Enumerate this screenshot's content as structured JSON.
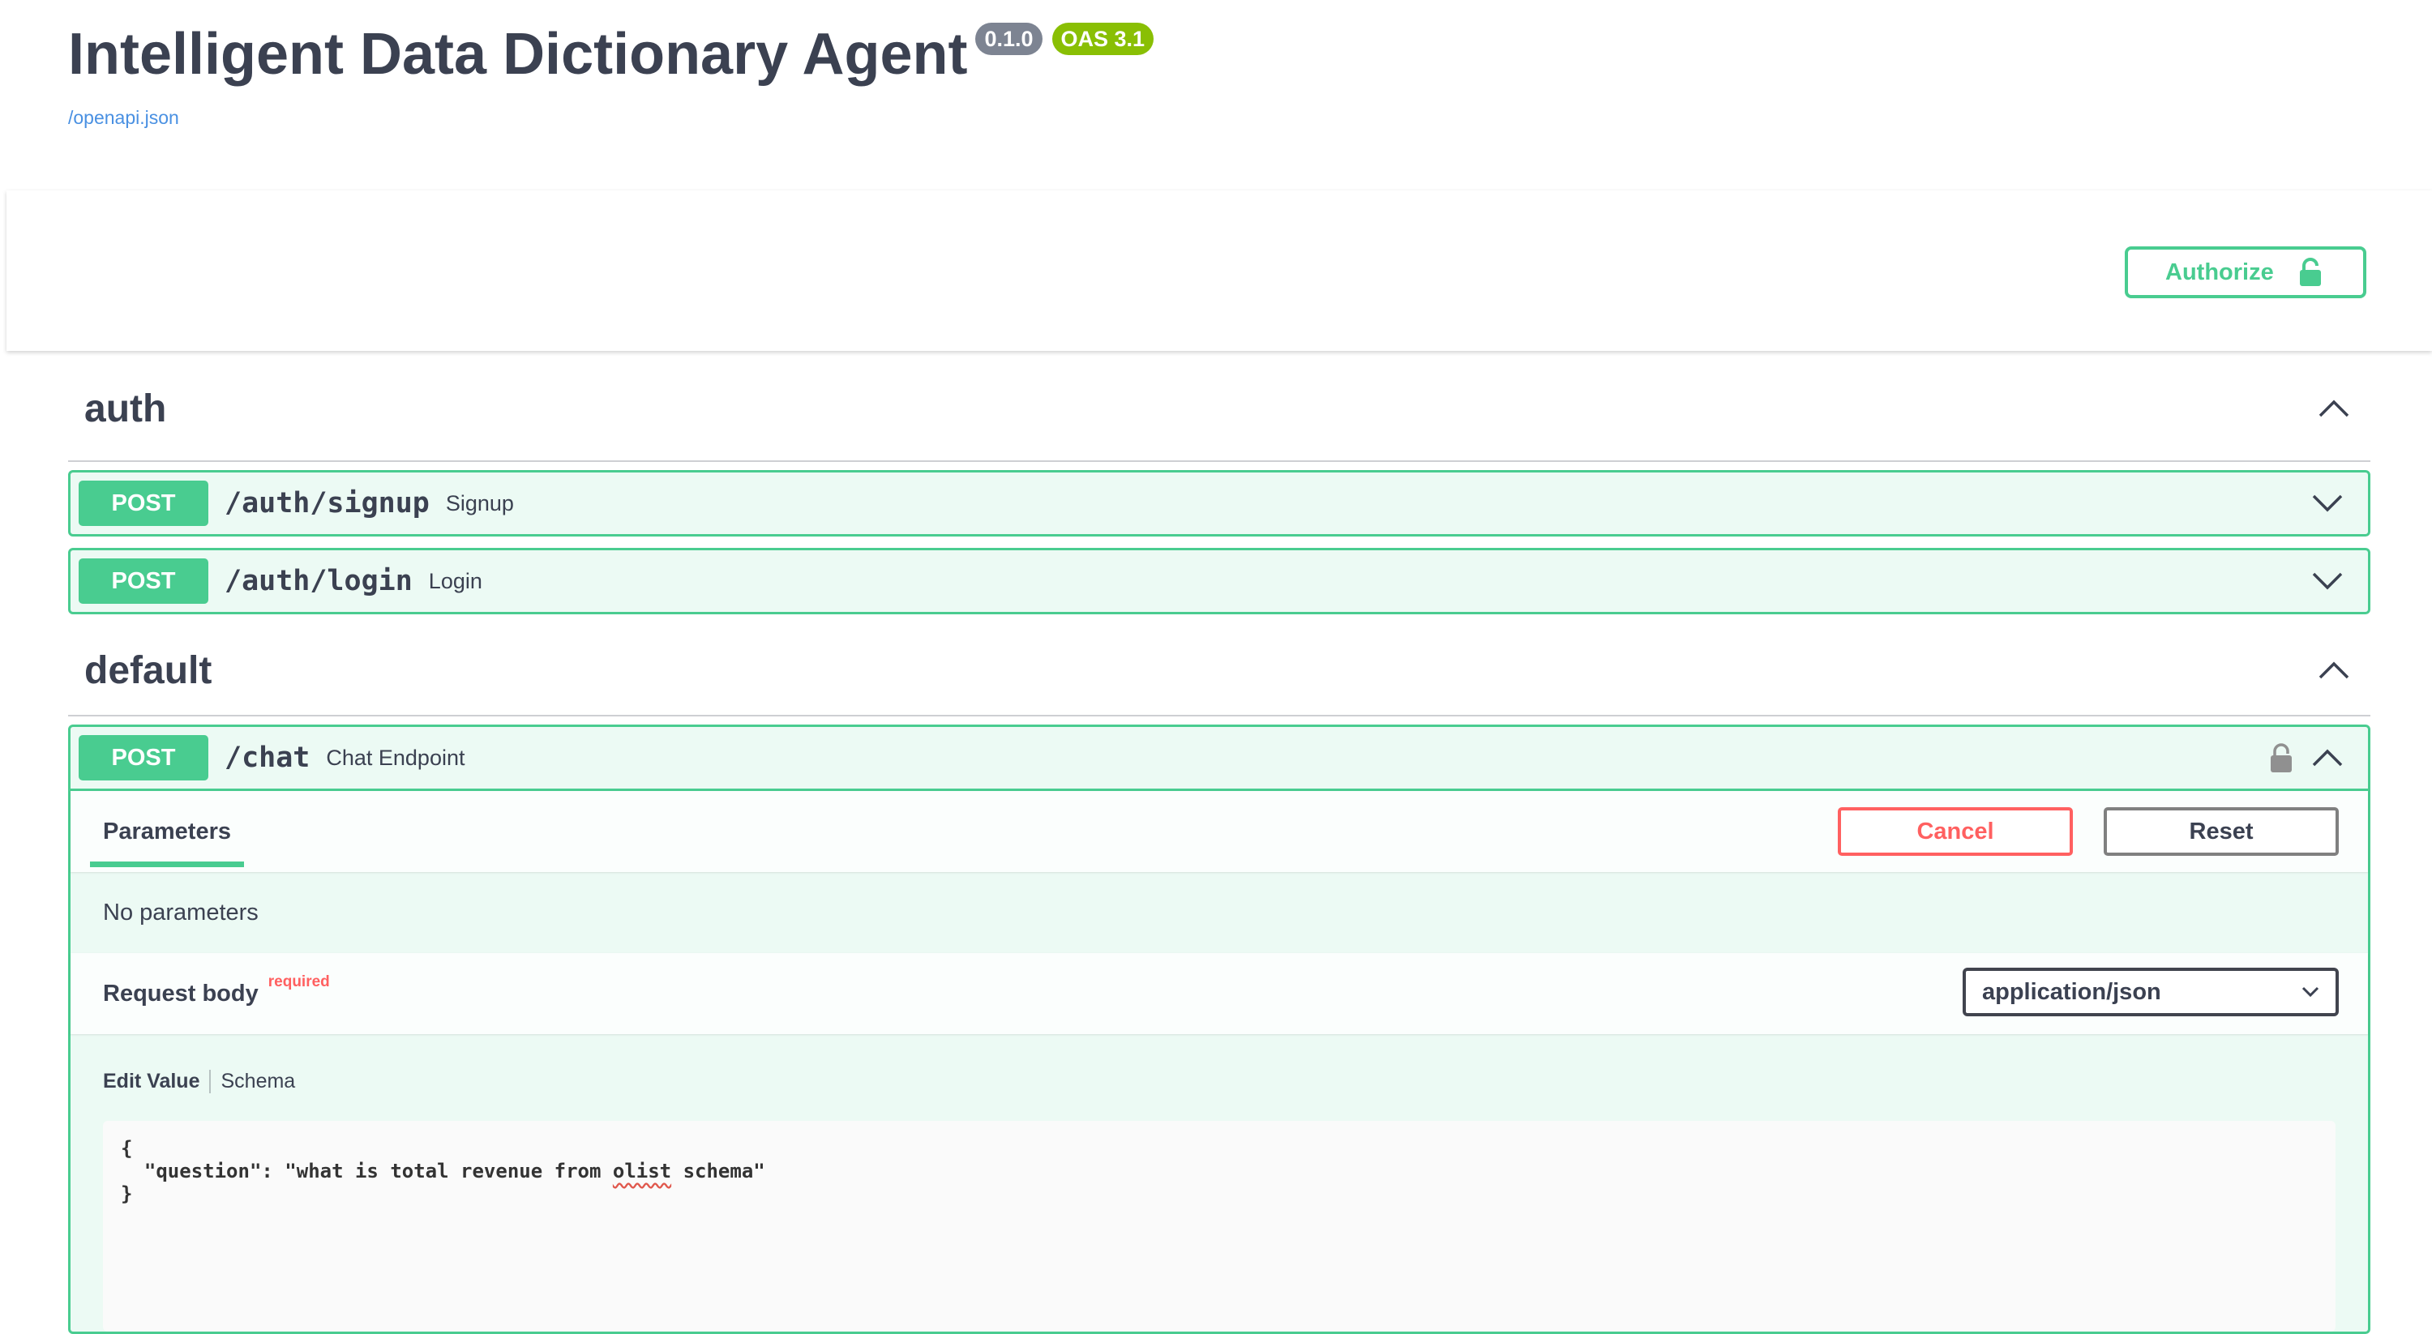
{
  "info": {
    "title": "Intelligent Data Dictionary Agent",
    "version": "0.1.0",
    "oas": "OAS 3.1",
    "spec_link": "/openapi.json"
  },
  "authorize": {
    "label": "Authorize"
  },
  "tags": {
    "auth": {
      "name": "auth",
      "ops": [
        {
          "method": "POST",
          "path": "/auth/signup",
          "summary": "Signup"
        },
        {
          "method": "POST",
          "path": "/auth/login",
          "summary": "Login"
        }
      ]
    },
    "default": {
      "name": "default",
      "op": {
        "method": "POST",
        "path": "/chat",
        "summary": "Chat Endpoint",
        "parameters_tab": "Parameters",
        "cancel_label": "Cancel",
        "reset_label": "Reset",
        "no_parameters": "No parameters",
        "request_body_label": "Request body",
        "required_label": "required",
        "content_type": "application/json",
        "edit_value_tab": "Edit Value",
        "schema_tab": "Schema",
        "body_open": "{",
        "body_key": "  \"question\": \"what is total revenue from ",
        "body_underlined": "olist",
        "body_rest": " schema\"",
        "body_close": "}"
      }
    }
  },
  "colors": {
    "post": "#49cc90",
    "cancel": "#ff6060",
    "link": "#4990e2",
    "oas_badge": "#89bf04",
    "version_badge": "#7d8492"
  }
}
